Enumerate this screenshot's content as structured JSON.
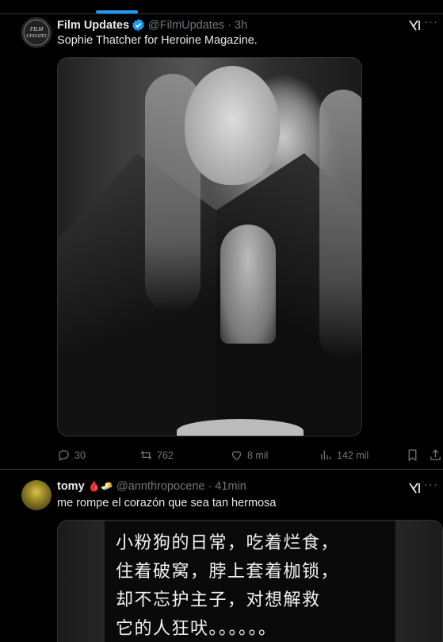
{
  "tweets": [
    {
      "author": "Film Updates",
      "handle": "@FilmUpdates",
      "time": "· 3h",
      "verified": true,
      "avatar_text": "FILM UPDATES",
      "text": "Sophie Thatcher for Heroine Magazine.",
      "actions": {
        "replies": "30",
        "retweets": "762",
        "likes": "8 mil",
        "views": "142 mil"
      }
    },
    {
      "author": "tomy",
      "emojis": "🩸🧈",
      "handle": "@annthropocene",
      "time": "· 41min",
      "text": "me rompe el corazón que sea tan hermosa",
      "media_text": [
        "小粉狗的日常，吃着烂食，",
        "住着破窝，脖上套着枷锁，",
        "却不忘护主子，对想解救",
        "它的人狂吠。。。。。。"
      ]
    }
  ],
  "colors": {
    "accent": "#1d9bf0",
    "border": "#2f3336",
    "muted": "#71767b",
    "text": "#e7e9ea",
    "background": "#000000"
  },
  "icons": [
    "verified-badge-icon",
    "grok-icon",
    "more-icon",
    "reply-icon",
    "retweet-icon",
    "like-icon",
    "views-icon",
    "bookmark-icon",
    "share-icon"
  ]
}
